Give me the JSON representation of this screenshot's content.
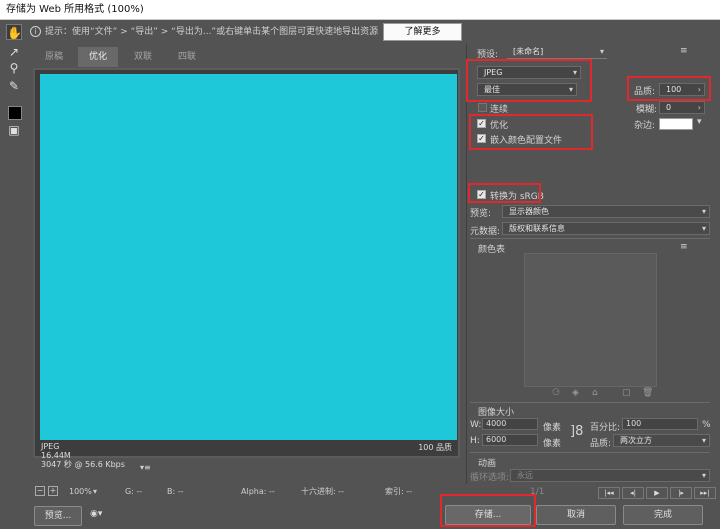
{
  "window": {
    "title": "存储为 Web 所用格式 (100%)"
  },
  "tip": {
    "text": "提示：使用“文件” > “导出” > “导出为...”或右键单击某个图层可更快速地导出资源",
    "learn_more": "了解更多"
  },
  "tabs": [
    {
      "label": "原稿",
      "active": false
    },
    {
      "label": "优化",
      "active": true
    },
    {
      "label": "双联",
      "active": false
    },
    {
      "label": "四联",
      "active": false
    }
  ],
  "preview": {
    "color": "#1ec8d8",
    "format": "JPEG",
    "size": "16.44M",
    "time": "3047 秒 @ 56.6 Kbps",
    "quality": "100 品质"
  },
  "statusbar": {
    "zoom": "100%",
    "g": "G: --",
    "b": "B: --",
    "alpha": "Alpha: --",
    "hex": "十六进制: --",
    "index": "索引: --"
  },
  "buttons": {
    "preview": "预览...",
    "save": "存储...",
    "cancel": "取消",
    "done": "完成"
  },
  "settings": {
    "preset_label": "预设:",
    "preset_value": "[未命名]",
    "format": "JPEG",
    "compression": "最佳",
    "quality_label": "品质:",
    "quality_value": "100",
    "progressive_label": "连续",
    "blur_label": "模糊:",
    "blur_value": "0",
    "optimize_label": "优化",
    "matte_label": "杂边:",
    "embed_profile_label": "嵌入颜色配置文件",
    "convert_srgb_label": "转换为 sRGB",
    "preview_label": "预览:",
    "preview_value": "显示器颜色",
    "metadata_label": "元数据:",
    "metadata_value": "版权和联系信息",
    "color_table_label": "颜色表"
  },
  "image_size": {
    "title": "图像大小",
    "w_label": "W:",
    "w_value": "4000",
    "h_label": "H:",
    "h_value": "6000",
    "unit": "像素",
    "percent_label": "百分比:",
    "percent_value": "100",
    "percent_unit": "%",
    "quality_label": "品质:",
    "quality_value": "两次立方"
  },
  "animation": {
    "title": "动画",
    "loop_label": "循环选项:",
    "loop_value": "永远",
    "frame": "1/1"
  },
  "colors": {
    "highlight": "#e0282d",
    "panel": "#535353"
  }
}
